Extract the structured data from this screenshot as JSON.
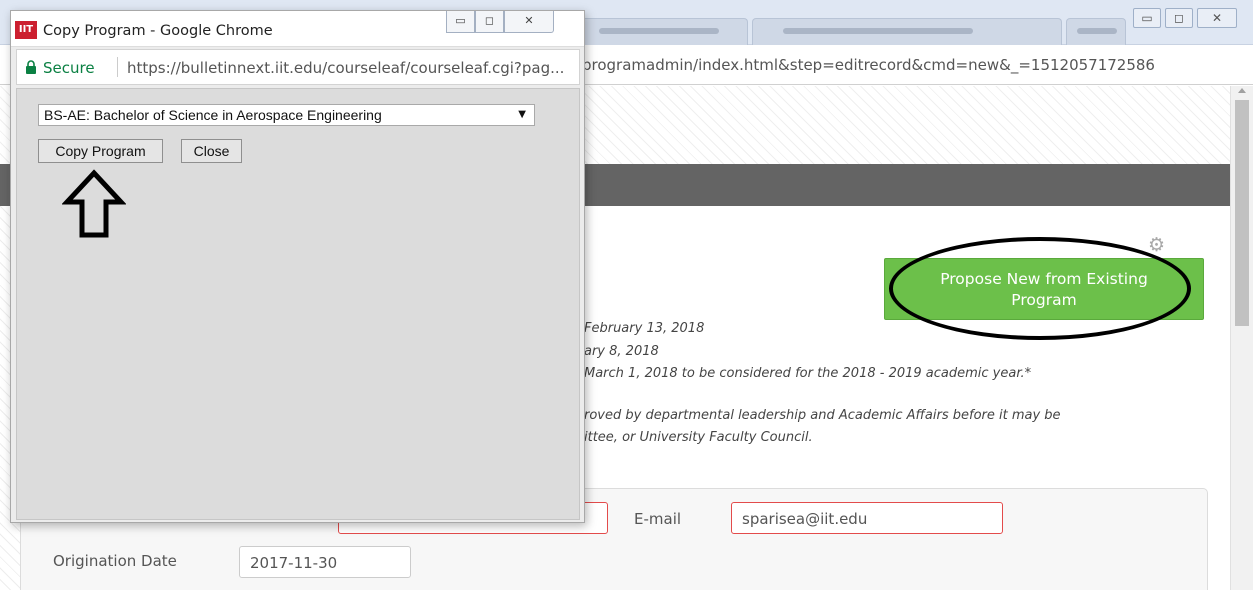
{
  "background_page": {
    "url_tail": "programadmin/index.html&step=editrecord&cmd=new&_=1512057172586",
    "propose_button": "Propose New from Existing Program",
    "info_lines": [
      "February 13, 2018",
      "ary 8, 2018",
      "March 1, 2018 to be considered for the 2018 - 2019 academic year.*",
      "roved by departmental leadership and Academic Affairs before it may be",
      "ittee, or University Faculty Council."
    ],
    "form": {
      "email_label": "E-mail",
      "email_value": "sparisea@iit.edu",
      "origination_label": "Origination Date",
      "origination_value": "2017-11-30"
    }
  },
  "popup": {
    "logo_text": "IIT",
    "title": "Copy Program - Google Chrome",
    "secure_label": "Secure",
    "url": "https://bulletinnext.iit.edu/courseleaf/courseleaf.cgi?pag...",
    "selected_program": "BS-AE: Bachelor of Science in Aerospace Engineering",
    "copy_button": "Copy Program",
    "close_button": "Close"
  },
  "colors": {
    "propose_green": "#6cc04a",
    "secure_green": "#0b8043",
    "error_red": "#e34b4b",
    "logo_red": "#cc1f2f"
  },
  "icons": [
    "lock-icon",
    "gear-icon",
    "dropdown-arrow-icon",
    "up-arrow-annotation",
    "minimize-icon",
    "maximize-icon",
    "close-icon"
  ]
}
